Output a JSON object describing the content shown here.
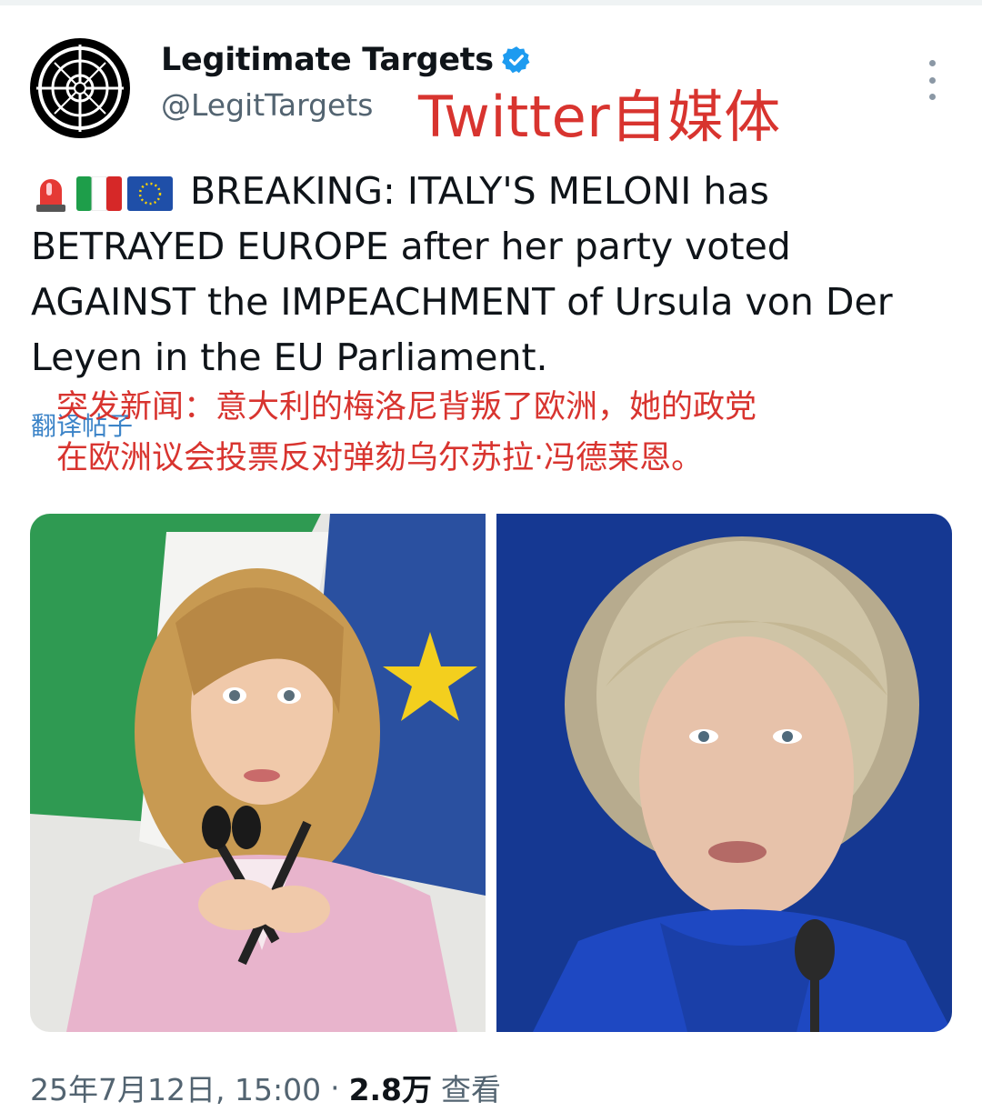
{
  "author": {
    "display_name": "Legitimate Targets",
    "handle": "@LegitTargets",
    "verified": true
  },
  "overlay_label": "Twitter自媒体",
  "tweet": {
    "emojis": [
      "rotating-light-icon",
      "italy-flag-icon",
      "eu-flag-icon"
    ],
    "text": "BREAKING: ITALY'S MELONI has BETRAYED EUROPE after her party voted AGAINST the IMPEACHMENT of Ursula von Der Leyen in the EU Parliament.",
    "translate_link": "翻译帖子",
    "translation_line1": "突发新闻：意大利的梅洛尼背叛了欧洲，她的政党",
    "translation_line2": "在欧洲议会投票反对弹劾乌尔苏拉·冯德莱恩。"
  },
  "meta": {
    "timestamp": "25年7月12日, 15:00",
    "separator": "·",
    "views_count": "2.8万",
    "views_label": "查看"
  },
  "colors": {
    "accent_red": "#d8342f",
    "link_blue": "#3c84c8",
    "verified_blue": "#1d9bf0",
    "secondary_text": "#536471"
  }
}
